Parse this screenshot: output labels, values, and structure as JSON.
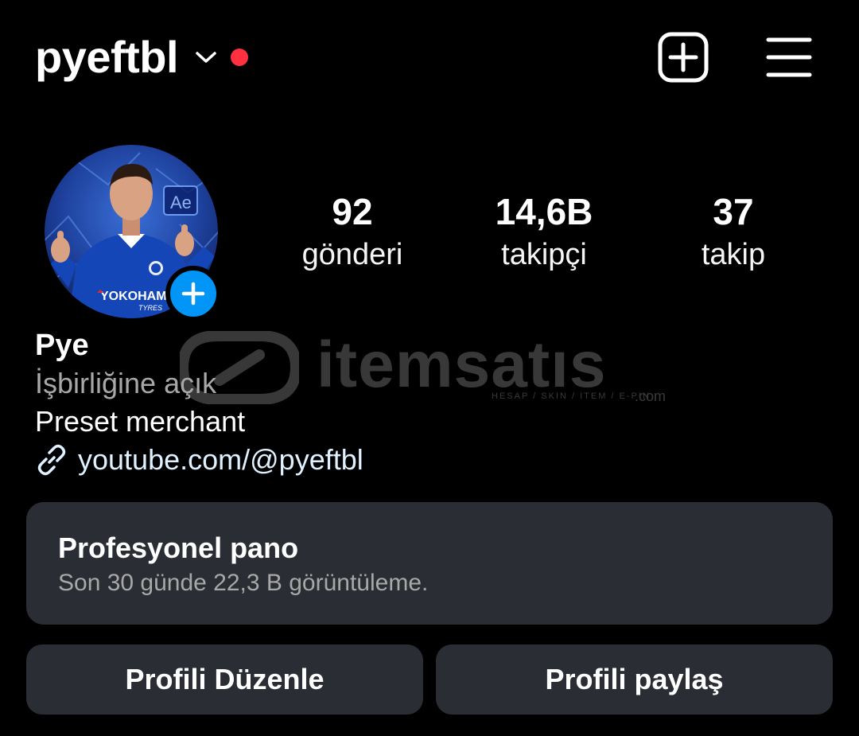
{
  "header": {
    "username": "pyeftbl",
    "chevron_icon": "chevron-down-icon",
    "notification_dot_color": "#ff3040",
    "add_icon": "plus-square-icon",
    "menu_icon": "hamburger-menu-icon"
  },
  "profile": {
    "avatar_icon": "profile-photo",
    "add_story_icon": "plus-icon",
    "add_story_color": "#0095f6"
  },
  "stats": {
    "posts": {
      "value": "92",
      "label": "gönderi"
    },
    "followers": {
      "value": "14,6B",
      "label": "takipçi"
    },
    "following": {
      "value": "37",
      "label": "takip"
    }
  },
  "bio": {
    "name": "Pye",
    "category": "İşbirliğine açık",
    "text": "Preset merchant",
    "link_icon": "link-icon",
    "link": "youtube.com/@pyeftbl"
  },
  "watermark": {
    "text": "itemsatıs",
    "subtitle": "HESAP / SKIN / ITEM / E-PIN",
    "suffix": ".com"
  },
  "dashboard": {
    "title": "Profesyonel pano",
    "subtitle": "Son 30 günde 22,3 B görüntüleme."
  },
  "actions": {
    "edit_label": "Profili Düzenle",
    "share_label": "Profili paylaş"
  },
  "colors": {
    "background": "#000000",
    "card": "#2a2d33",
    "secondary_text": "#a8a8a8",
    "link_text": "#e0f1ff"
  }
}
